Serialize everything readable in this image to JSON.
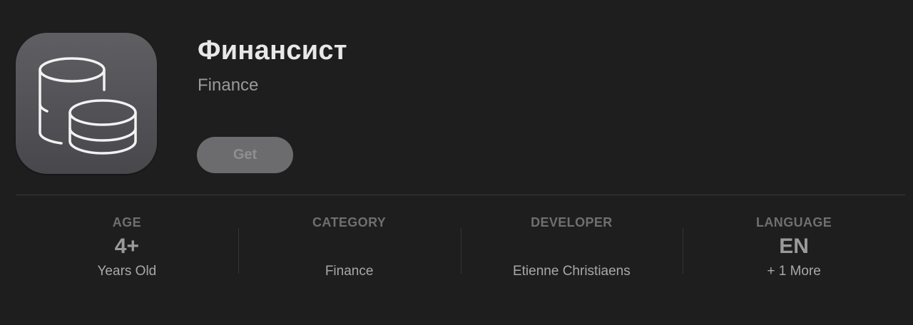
{
  "app": {
    "title": "Финансист",
    "subtitle": "Finance",
    "get_label": "Get",
    "icon": "stacked-coins-icon"
  },
  "info": {
    "age": {
      "label": "AGE",
      "value": "4+",
      "sub": "Years Old"
    },
    "category": {
      "label": "CATEGORY",
      "value": "",
      "sub": "Finance"
    },
    "developer": {
      "label": "DEVELOPER",
      "value": "",
      "sub": "Etienne Christiaens"
    },
    "language": {
      "label": "LANGUAGE",
      "value": "EN",
      "sub": "+ 1 More"
    }
  },
  "colors": {
    "background": "#1e1e1e",
    "icon_bg": "#545458",
    "button_bg": "#6c6c6e"
  }
}
